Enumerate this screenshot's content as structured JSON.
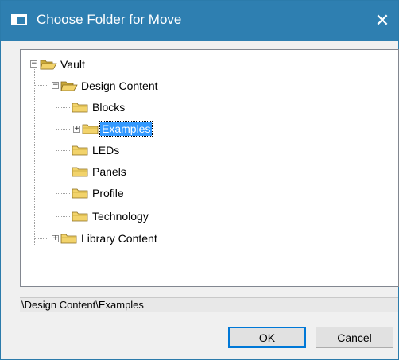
{
  "window": {
    "title": "Choose Folder for Move",
    "title_icon": "window-icon",
    "close_glyph": "✕"
  },
  "tree": {
    "root": {
      "label": "Vault",
      "expanded": true
    },
    "design_content": {
      "label": "Design Content",
      "expanded": true
    },
    "children": [
      {
        "label": "Blocks"
      },
      {
        "label": "Examples",
        "selected": true,
        "has_children": true
      },
      {
        "label": "LEDs"
      },
      {
        "label": "Panels"
      },
      {
        "label": "Profile"
      },
      {
        "label": "Technology"
      }
    ],
    "library_content": {
      "label": "Library Content",
      "expanded": false
    }
  },
  "expander": {
    "expanded_glyph": "−",
    "collapsed_glyph": "+"
  },
  "path": "\\Design Content\\Examples",
  "buttons": {
    "ok": "OK",
    "cancel": "Cancel"
  },
  "colors": {
    "titlebar": "#2e7fb1",
    "selection": "#3399ff",
    "folder": "#f2d36b",
    "default_button_border": "#0078d7"
  }
}
